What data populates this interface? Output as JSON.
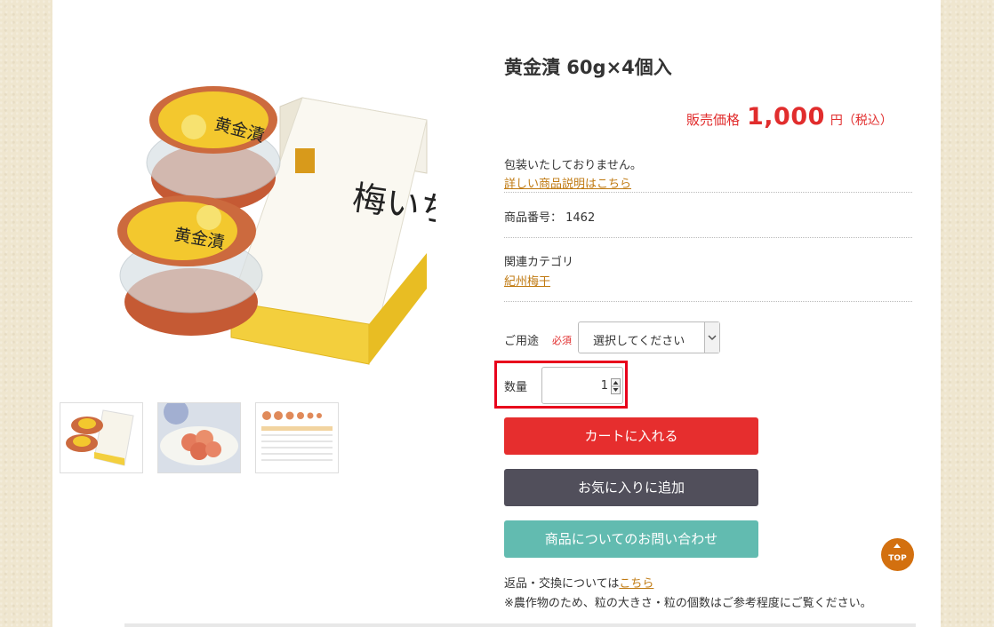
{
  "product": {
    "title": "黄金漬 60g×4個入",
    "price_label": "販売価格",
    "price_value": "1,000",
    "price_unit": "円（税込）",
    "packaging_note": "包装いたしておりません。",
    "details_link": "詳しい商品説明はこちら",
    "product_number": "商品番号： 1462",
    "category_label": "関連カテゴリ",
    "category_link": "紀州梅干"
  },
  "image_text": {
    "cup_label": "黄金漬",
    "box_title": "梅いちばん"
  },
  "form": {
    "usage_label": "ご用途",
    "required_label": "必須",
    "usage_selected": "選択してください",
    "quantity_label": "数量",
    "quantity_value": "1"
  },
  "buttons": {
    "add_to_cart": "カートに入れる",
    "add_to_favorites": "お気に入りに追加",
    "inquiry": "商品についてのお問い合わせ",
    "top": "TOP"
  },
  "footer_notes": {
    "returns_prefix": "返品・交換については",
    "returns_link": "こちら",
    "disclaimer": "※農作物のため、粒の大きさ・粒の個数はご参考程度にご覧ください。"
  },
  "colors": {
    "price_red": "#e12d2d",
    "cart_red": "#e62e2e",
    "favorite_dark": "#514f5b",
    "inquiry_teal": "#62bbb0",
    "link_orange": "#c07a12",
    "highlight_red": "#e8001c",
    "top_orange": "#d3700f"
  }
}
